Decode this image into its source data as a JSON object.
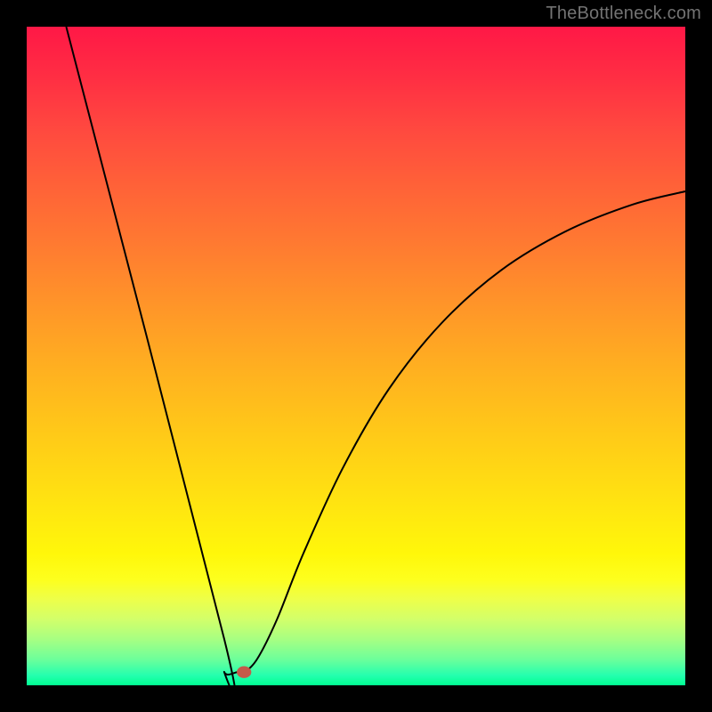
{
  "watermark_text": "TheBottleneck.com",
  "chart_data": {
    "type": "line",
    "title": "",
    "xlabel": "",
    "ylabel": "",
    "categories_visible": false,
    "values_visible": false,
    "ylim": [
      0,
      100
    ],
    "xlim": [
      0,
      100
    ],
    "gradient_stops": [
      {
        "pct": 0,
        "color": "#ff1846"
      },
      {
        "pct": 8,
        "color": "#ff2f43"
      },
      {
        "pct": 16,
        "color": "#ff4a3f"
      },
      {
        "pct": 24,
        "color": "#ff6138"
      },
      {
        "pct": 33,
        "color": "#ff7a31"
      },
      {
        "pct": 42,
        "color": "#ff9429"
      },
      {
        "pct": 52,
        "color": "#ffb020"
      },
      {
        "pct": 62,
        "color": "#ffca18"
      },
      {
        "pct": 72,
        "color": "#ffe311"
      },
      {
        "pct": 80,
        "color": "#fff70a"
      },
      {
        "pct": 84,
        "color": "#fdff1e"
      },
      {
        "pct": 87,
        "color": "#edff4a"
      },
      {
        "pct": 90,
        "color": "#d2ff6a"
      },
      {
        "pct": 93,
        "color": "#a7ff82"
      },
      {
        "pct": 96,
        "color": "#6eff9a"
      },
      {
        "pct": 98.5,
        "color": "#24ffae"
      },
      {
        "pct": 100,
        "color": "#00ff92"
      }
    ],
    "series": [
      {
        "name": "bottleneck-curve",
        "points": [
          {
            "x": 6,
            "y": 100
          },
          {
            "x": 30,
            "y": 7
          },
          {
            "x": 30,
            "y": 2
          },
          {
            "x": 32,
            "y": 2
          },
          {
            "x": 33,
            "y": 2
          },
          {
            "x": 35,
            "y": 4
          },
          {
            "x": 38,
            "y": 10
          },
          {
            "x": 42,
            "y": 20
          },
          {
            "x": 48,
            "y": 33
          },
          {
            "x": 55,
            "y": 45
          },
          {
            "x": 63,
            "y": 55
          },
          {
            "x": 72,
            "y": 63
          },
          {
            "x": 82,
            "y": 69
          },
          {
            "x": 92,
            "y": 73
          },
          {
            "x": 100,
            "y": 75
          }
        ]
      }
    ],
    "marker": {
      "x": 33,
      "y": 2,
      "rx": 1.1,
      "ry": 0.9,
      "color": "#c45a4a"
    }
  }
}
